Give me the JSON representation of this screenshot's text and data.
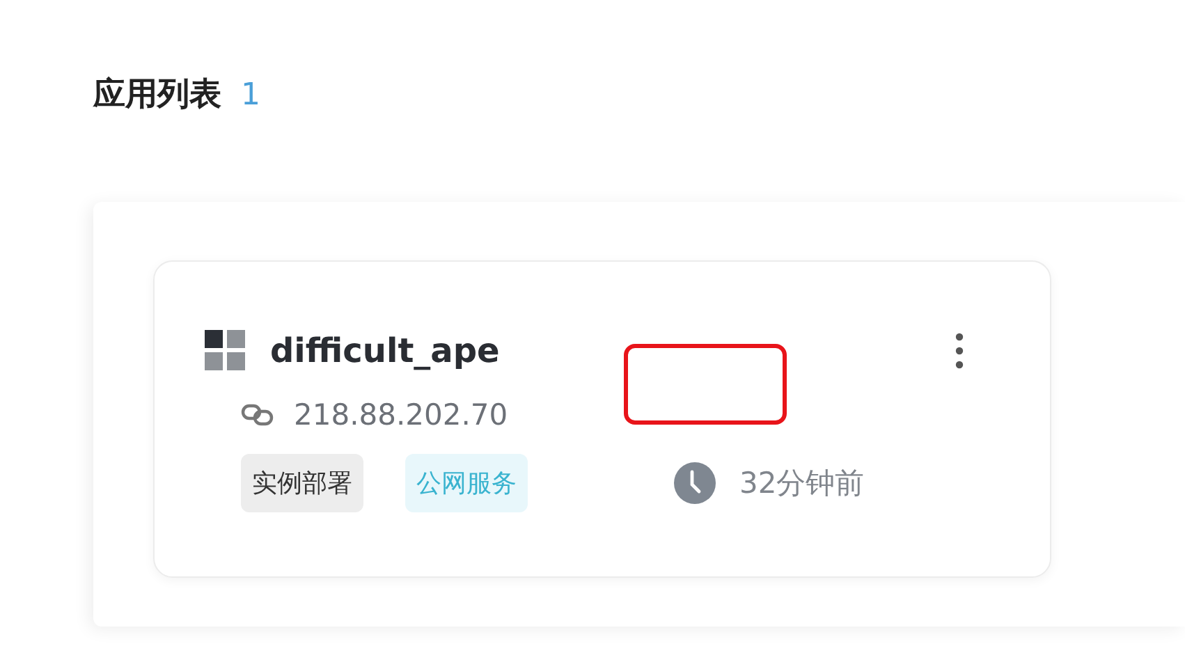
{
  "header": {
    "title": "应用列表",
    "count": "1"
  },
  "apps": [
    {
      "name": "difficult_ape",
      "address": "218.88.202.70",
      "tags": [
        {
          "label": "实例部署",
          "kind": "neutral"
        },
        {
          "label": "公网服务",
          "kind": "accent"
        }
      ],
      "time": "32分钟前"
    }
  ]
}
